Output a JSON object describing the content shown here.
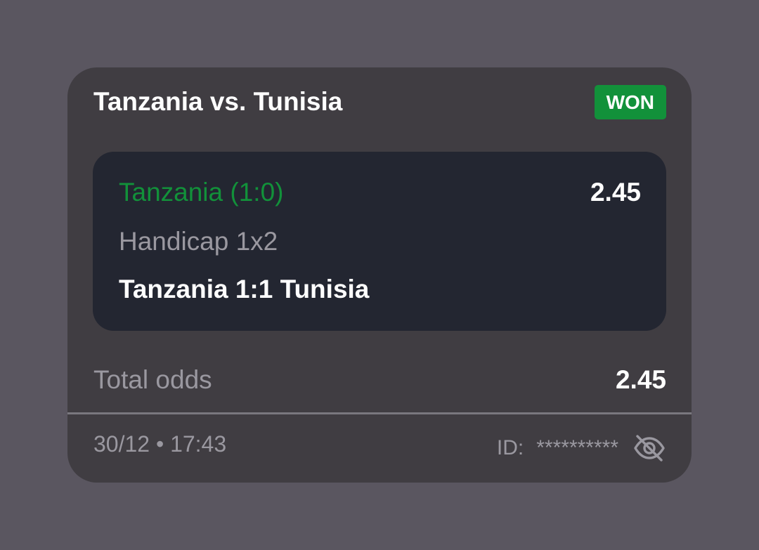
{
  "bet": {
    "match_title": "Tanzania vs. Tunisia",
    "status": "WON",
    "selection": {
      "pick": "Tanzania (1:0)",
      "odds": "2.45",
      "market": "Handicap 1x2",
      "result": "Tanzania 1:1 Tunisia"
    },
    "total_label": "Total odds",
    "total_value": "2.45",
    "timestamp": "30/12 • 17:43",
    "id_label": "ID:",
    "id_value": "**********"
  },
  "icons": {
    "visibility_toggle": "eye-off-icon"
  },
  "colors": {
    "background": "#5a5660",
    "card": "#403d42",
    "selection_box": "#232631",
    "won_green": "#12913a",
    "muted_text": "#9a98a0",
    "primary_text": "#ffffff"
  }
}
